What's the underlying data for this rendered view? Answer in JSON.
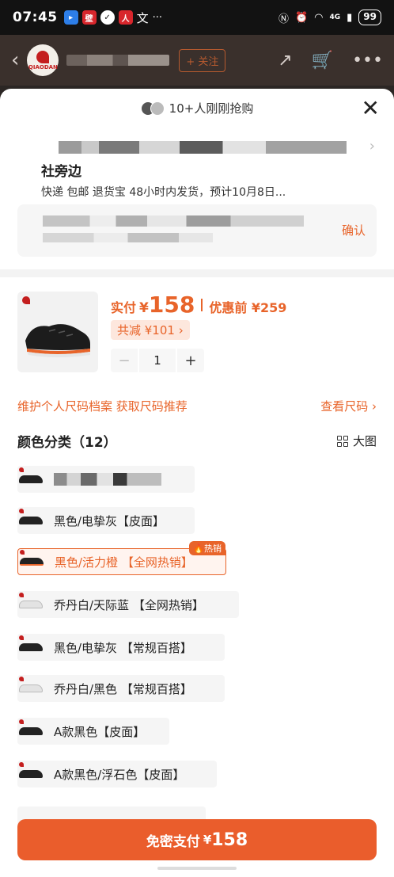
{
  "status": {
    "time": "07:45",
    "net_label": "4G",
    "battery": "99"
  },
  "header": {
    "back_icon": "chevron-left-icon",
    "follow_label": "+ 关注",
    "logo_text": "QIAODAN"
  },
  "sheet": {
    "rush_text": "10+人刚刚抢购",
    "address": {
      "name": "社旁边",
      "shipping": "快递 包邮 退货宝 48小时内发货，预计10月8日..."
    },
    "confirm_label": "确认"
  },
  "product": {
    "price_label": "实付",
    "currency": "¥",
    "price": "158",
    "original_label": "优惠前 ¥259",
    "discount_label": "共减 ¥101 ›",
    "quantity": "1",
    "minus": "−",
    "plus": "+"
  },
  "size": {
    "profile_label": "维护个人尺码档案 获取尺码推荐",
    "check_label": "查看尺码 ›"
  },
  "colors": {
    "title": "颜色分类（12）",
    "big_view_label": "大图",
    "options": [
      {
        "label": "",
        "blurred": true,
        "shoe": "black"
      },
      {
        "label": "黑色/电挚灰【皮面】",
        "shoe": "black"
      },
      {
        "label": "黑色/活力橙 【全网热销】",
        "shoe": "orange",
        "selected": true,
        "badge": "热销"
      },
      {
        "label": "乔丹白/天际蓝 【全网热销】",
        "shoe": "white"
      },
      {
        "label": "黑色/电挚灰 【常规百搭】",
        "shoe": "black"
      },
      {
        "label": "乔丹白/黑色 【常规百搭】",
        "shoe": "white"
      },
      {
        "label": "A款黑色【皮面】",
        "shoe": "black"
      },
      {
        "label": "A款黑色/浮石色【皮面】",
        "shoe": "black"
      }
    ]
  },
  "pay": {
    "label": "免密支付",
    "currency": "¥",
    "amount": "158"
  },
  "colors_theme": {
    "accent": "#e8642a",
    "pay_button": "#ea5d2c"
  }
}
